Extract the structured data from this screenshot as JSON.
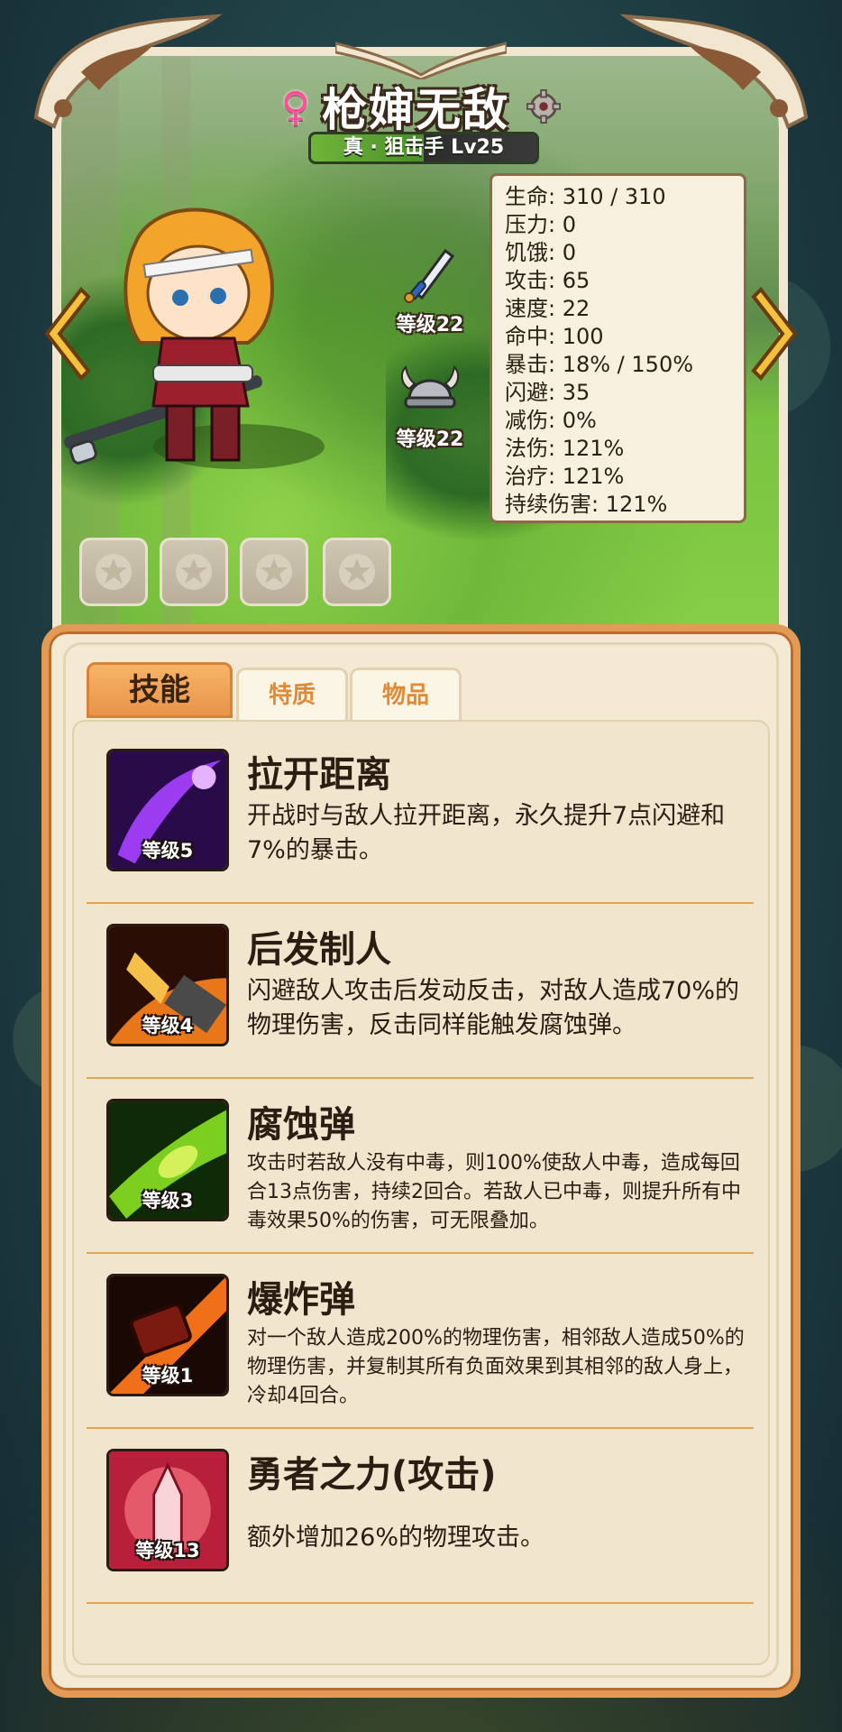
{
  "hero": {
    "name": "枪婶无敌",
    "gender_icon": "♀",
    "class_level": "真 · 狙击手 Lv25"
  },
  "equipment": {
    "weapon": {
      "icon": "sword-icon",
      "level": "等级22"
    },
    "helmet": {
      "icon": "viking-helmet-icon",
      "level": "等级22"
    }
  },
  "stats": [
    "生命: 310 / 310",
    "压力: 0",
    "饥饿: 0",
    "攻击: 65",
    "速度: 22",
    "命中: 100",
    "暴击: 18% / 150%",
    "闪避: 35",
    "减伤: 0%",
    "法伤: 121%",
    "治疗: 121%",
    "持续伤害: 121%"
  ],
  "tabs": {
    "skills": "技能",
    "traits": "特质",
    "items": "物品"
  },
  "skills": [
    {
      "name": "拉开距离",
      "level": "等级5",
      "desc": "开战时与敌人拉开距离，永久提升7点闪避和7%的暴击。",
      "color": "#7a2fd1"
    },
    {
      "name": "后发制人",
      "level": "等级4",
      "desc": "闪避敌人攻击后发动反击，对敌人造成70%的物理伤害，反击同样能触发腐蚀弹。",
      "color": "#e07a1a"
    },
    {
      "name": "腐蚀弹",
      "level": "等级3",
      "desc": "攻击时若敌人没有中毒，则100%使敌人中毒，造成每回合13点伤害，持续2回合。若敌人已中毒，则提升所有中毒效果50%的伤害，可无限叠加。",
      "color": "#6fb81f"
    },
    {
      "name": "爆炸弹",
      "level": "等级1",
      "desc": "对一个敌人造成200%的物理伤害，相邻敌人造成50%的物理伤害，并复制其所有负面效果到其相邻的敌人身上，冷却4回合。",
      "color": "#e05a12"
    },
    {
      "name": "勇者之力(攻击)",
      "level": "等级13",
      "desc": "额外增加26%的物理攻击。",
      "color": "#d83a4a"
    }
  ],
  "colors": {
    "panel_border": "#e39a55",
    "tab_active": "#f0a458",
    "tab_text": "#e08a36"
  }
}
